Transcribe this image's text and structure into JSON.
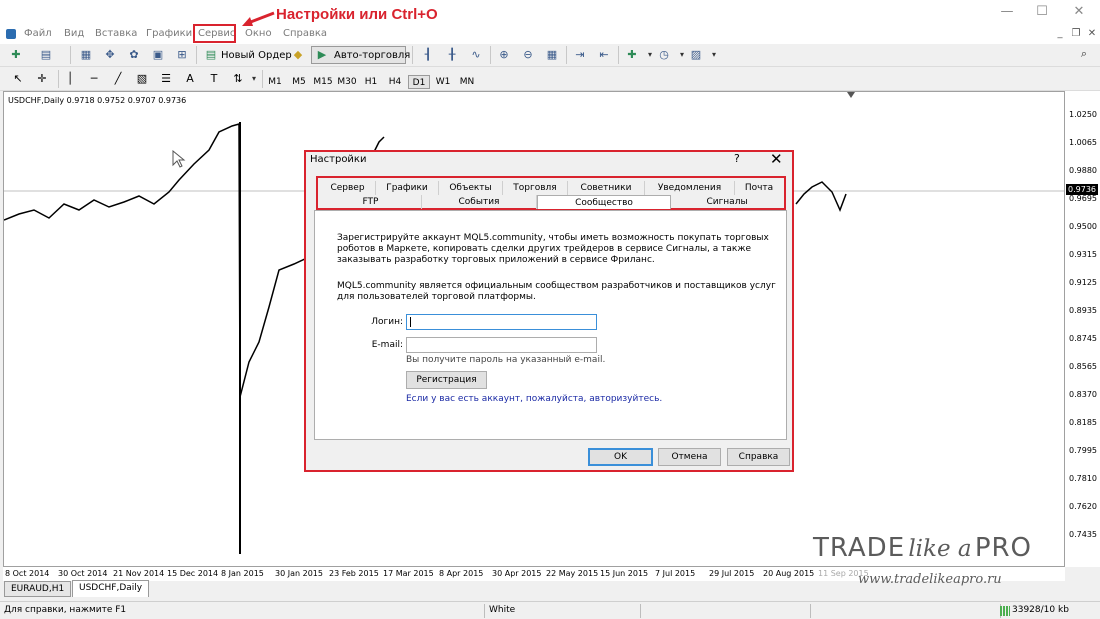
{
  "menu": {
    "items": [
      "Файл",
      "Вид",
      "Вставка",
      "Графики",
      "Сервис",
      "Окно",
      "Справка"
    ],
    "annotation": "Настройки или Ctrl+O"
  },
  "window_controls": {
    "minimize": "—",
    "maximize": "☐",
    "close": "✕"
  },
  "toolbar": {
    "new_order": "Новый Ордер",
    "auto_trading": "Авто-торговля",
    "timeframes": [
      "M1",
      "M5",
      "M15",
      "M30",
      "H1",
      "H4",
      "D1",
      "W1",
      "MN"
    ],
    "active_timeframe": "D1"
  },
  "chart": {
    "label": "USDCHF,Daily  0.9718 0.9752 0.9707 0.9736",
    "current_price": "0.9736",
    "prices": [
      "1.0250",
      "1.0065",
      "0.9880",
      "0.9695",
      "0.9500",
      "0.9315",
      "0.9125",
      "0.8935",
      "0.8745",
      "0.8565",
      "0.8370",
      "0.8185",
      "0.7995",
      "0.7810",
      "0.7620",
      "0.7435"
    ],
    "dates": [
      "8 Oct 2014",
      "30 Oct 2014",
      "21 Nov 2014",
      "15 Dec 2014",
      "8 Jan 2015",
      "30 Jan 2015",
      "23 Feb 2015",
      "17 Mar 2015",
      "8 Apr 2015",
      "30 Apr 2015",
      "22 May 2015",
      "15 Jun 2015",
      "7 Jul 2015",
      "29 Jul 2015",
      "20 Aug 2015",
      "11 Sep 2015"
    ]
  },
  "chart_tabs": [
    "EURAUD,H1",
    "USDCHF,Daily"
  ],
  "status": {
    "help": "Для справки, нажмите F1",
    "profile": "White",
    "traffic": "33928/10 kb"
  },
  "dialog": {
    "title": "Настройки",
    "help": "?",
    "close": "✕",
    "tabs_row1": [
      "Сервер",
      "Графики",
      "Объекты",
      "Торговля",
      "Советники",
      "Уведомления",
      "Почта"
    ],
    "tabs_row2": [
      "FTP",
      "События",
      "Сообщество",
      "Сигналы"
    ],
    "active_tab": "Сообщество",
    "text1": "Зарегистрируйте аккаунт MQL5.community, чтобы иметь возможность покупать торговых роботов в Маркете, копировать сделки других трейдеров в сервисе Сигналы, а также заказывать разработку торговых приложений в сервисе Фриланс.",
    "text2": "MQL5.community является официальным сообществом разработчиков и поставщиков услуг для пользователей торговой платформы.",
    "login_label": "Логин:",
    "login_value": "",
    "email_label": "E-mail:",
    "email_value": "",
    "email_hint": "Вы получите пароль на указанный e-mail.",
    "register_button": "Регистрация",
    "auth_link": "Если у вас есть аккаунт, пожалуйста, авторизуйтесь.",
    "ok_button": "OK",
    "cancel_button": "Отмена",
    "help_button": "Справка"
  },
  "watermark": {
    "trade": "TRADE",
    "like_a": "like a",
    "pro": "PRO",
    "site": "www.tradelikeapro.ru"
  },
  "colors": {
    "highlight": "#d9232e",
    "link": "#1b2aa5",
    "focus": "#3a8fd9"
  }
}
